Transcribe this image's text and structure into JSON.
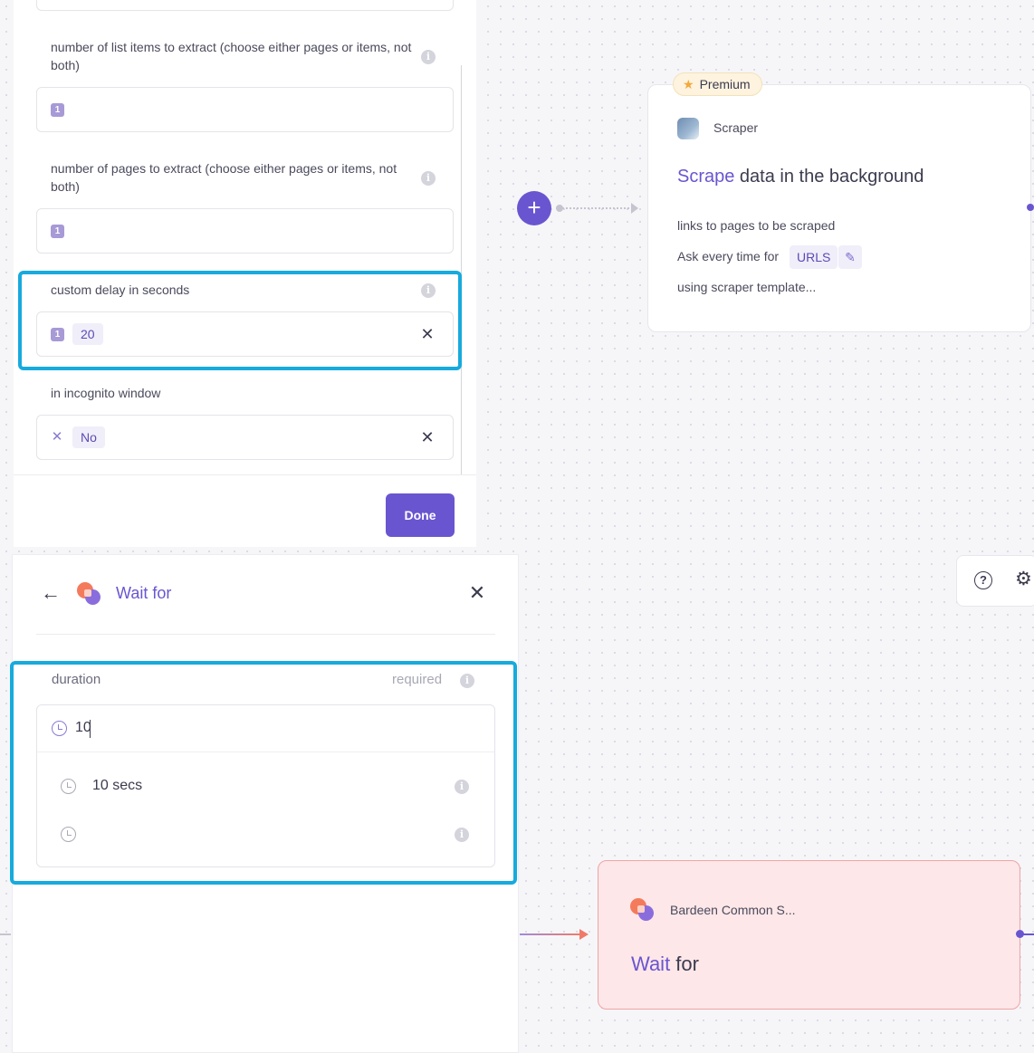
{
  "config_panel": {
    "fields": [
      {
        "label": "number of list items to extract (choose either pages or items, not both)",
        "badge": "1"
      },
      {
        "label": "number of pages to extract (choose either pages or items, not both)",
        "badge": "1"
      },
      {
        "label": "custom delay in seconds",
        "badge": "1",
        "value": "20"
      },
      {
        "label": "in incognito window",
        "value": "No"
      }
    ],
    "done_label": "Done"
  },
  "scraper_card": {
    "badge": "Premium",
    "app_name": "Scraper",
    "title_accent": "Scrape",
    "title_rest": " data in the background",
    "line1": "links to pages to be scraped",
    "line2": "Ask every time for",
    "urls_chip": "URLS",
    "line3": "using scraper template..."
  },
  "wait_panel": {
    "title": "Wait for",
    "field_label": "duration",
    "required_label": "required",
    "input_value": "10",
    "options": [
      "10 secs",
      ""
    ]
  },
  "wait_node": {
    "app_name": "Bardeen Common S...",
    "title_accent": "Wait",
    "title_rest": " for"
  },
  "icons": {
    "info": "info-icon",
    "clear": "close-icon",
    "help": "help-icon",
    "settings": "gear-icon",
    "back": "arrow-left-icon",
    "clock": "clock-icon",
    "star": "star-icon",
    "edit": "pencil-icon"
  },
  "colors": {
    "accent": "#6a55d0",
    "highlight": "#17aadd",
    "node_bg": "#fde7e8",
    "node_border": "#f0a3a6"
  }
}
